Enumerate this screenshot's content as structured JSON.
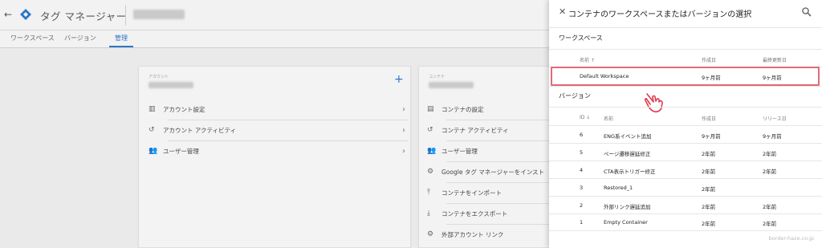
{
  "header": {
    "back_icon": "arrow-left-icon",
    "app_title": "タグ マネージャー",
    "logo_icon": "gtm-diamond-icon"
  },
  "tabs": [
    {
      "label": "ワークスペース",
      "active": false
    },
    {
      "label": "バージョン",
      "active": false
    },
    {
      "label": "管理",
      "active": true
    }
  ],
  "account_card": {
    "caption": "アカウント",
    "add_icon": "+",
    "items": [
      {
        "label": "アカウント設定",
        "icon": "building-icon"
      },
      {
        "label": "アカウント アクティビティ",
        "icon": "history-icon"
      },
      {
        "label": "ユーザー管理",
        "icon": "users-icon"
      }
    ]
  },
  "container_card": {
    "caption": "コンテナ",
    "items": [
      {
        "label": "コンテナの設定",
        "icon": "container-icon"
      },
      {
        "label": "コンテナ アクティビティ",
        "icon": "history-icon"
      },
      {
        "label": "ユーザー管理",
        "icon": "users-icon"
      },
      {
        "label": "Google タグ マネージャーをインスト",
        "icon": "gear-icon"
      },
      {
        "label": "コンテナをインポート",
        "icon": "upload-icon"
      },
      {
        "label": "コンテナをエクスポート",
        "icon": "download-icon"
      },
      {
        "label": "外部アカウント リンク",
        "icon": "gear-icon"
      }
    ]
  },
  "panel": {
    "title": "コンテナのワークスペースまたはバージョンの選択",
    "workspace_section": "ワークスペース",
    "workspace_headers": {
      "name": "名前 ↑",
      "created": "作成日",
      "updated": "最終更新日"
    },
    "workspaces": [
      {
        "name": "Default Workspace",
        "created": "9ヶ月前",
        "updated": "9ヶ月前"
      }
    ],
    "version_section": "バージョン",
    "version_headers": {
      "id": "ID ↓",
      "name": "名前",
      "created": "作成日",
      "released": "リリース日"
    },
    "versions": [
      {
        "id": "6",
        "name": "ENG系イベント追加",
        "created": "9ヶ月前",
        "released": "9ヶ月前"
      },
      {
        "id": "5",
        "name": "ページ遷移遅延修正",
        "created": "2年前",
        "released": "2年前"
      },
      {
        "id": "4",
        "name": "CTA表示トリガー修正",
        "created": "2年前",
        "released": "2年前"
      },
      {
        "id": "3",
        "name": "Restored_1",
        "created": "2年前",
        "released": ""
      },
      {
        "id": "2",
        "name": "外部リンク遅延追加",
        "created": "2年前",
        "released": "2年前"
      },
      {
        "id": "1",
        "name": "Empty Container",
        "created": "2年前",
        "released": "2年前"
      }
    ],
    "watermark": "border-haze.co.jp"
  }
}
